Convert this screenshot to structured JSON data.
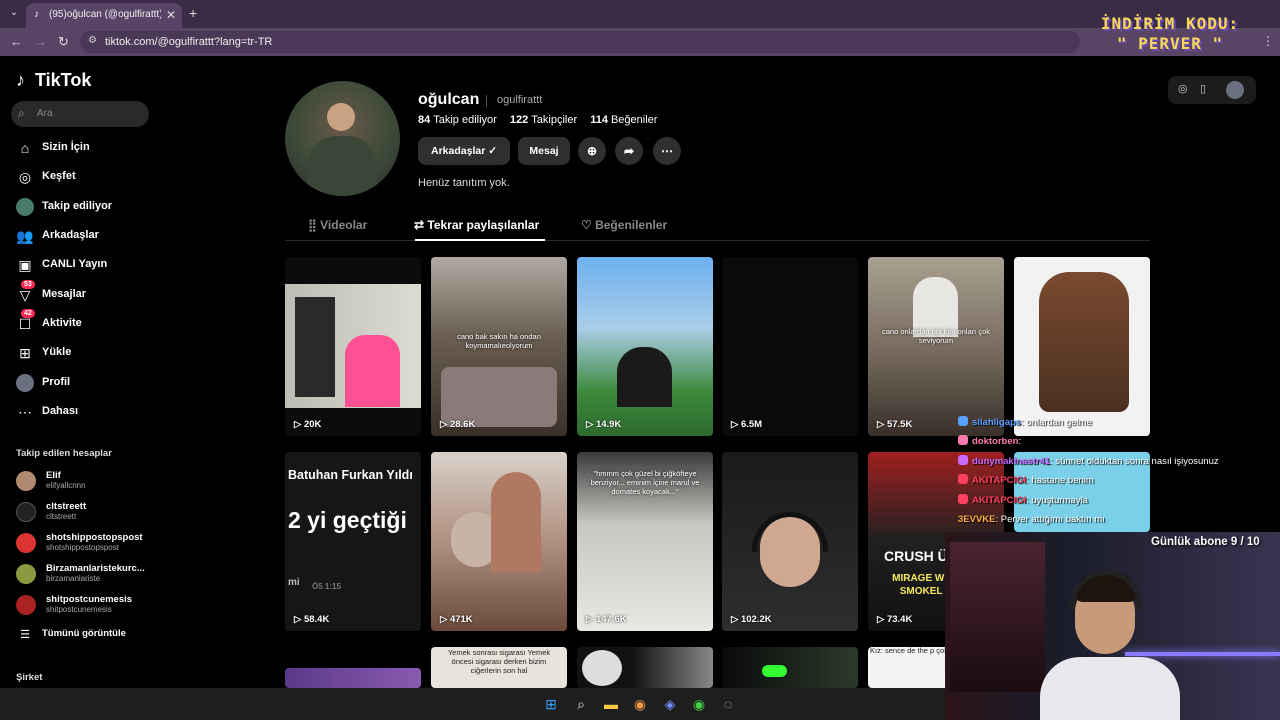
{
  "browser": {
    "tab_title": "(95)oğulcan (@ogulfirattt) | Tik",
    "tab_close": "✕",
    "new_tab": "+",
    "url": "tiktok.com/@ogulfirattt?lang=tr-TR"
  },
  "promo": {
    "line1": "İNDİRİM KODU:",
    "line2": "\" PERVER \""
  },
  "sidebar": {
    "logo": "TikTok",
    "search_placeholder": "Ara",
    "nav": [
      {
        "label": "Sizin İçin",
        "icon": "home-icon"
      },
      {
        "label": "Keşfet",
        "icon": "compass-icon"
      },
      {
        "label": "Takip ediliyor",
        "icon": "following-avatar-icon"
      },
      {
        "label": "Arkadaşlar",
        "icon": "friends-icon"
      },
      {
        "label": "CANLI Yayın",
        "icon": "live-icon"
      },
      {
        "label": "Mesajlar",
        "icon": "messages-icon",
        "badge": "53"
      },
      {
        "label": "Aktivite",
        "icon": "activity-icon",
        "badge": "42"
      },
      {
        "label": "Yükle",
        "icon": "upload-icon"
      },
      {
        "label": "Profil",
        "icon": "profile-avatar-icon"
      },
      {
        "label": "Dahası",
        "icon": "more-icon"
      }
    ],
    "followed_title": "Takip edilen hesaplar",
    "accounts": [
      {
        "name": "Elif",
        "handle": "elifyallcnnn",
        "color": "#b08a70"
      },
      {
        "name": "cltstreett",
        "handle": "cltstreett",
        "color": "#222"
      },
      {
        "name": "shotshippostopspost",
        "handle": "shotshippostopspost",
        "color": "#d33"
      },
      {
        "name": "Birzamanlaristekurc...",
        "handle": "birzamanlariste",
        "color": "#8a9a40"
      },
      {
        "name": "shitpostcunemesis",
        "handle": "shitpostcunemesis",
        "color": "#a22"
      }
    ],
    "view_all": "Tümünü görüntüle",
    "company": "Şirket"
  },
  "profile": {
    "name": "oğulcan",
    "handle": "ogulfirattt",
    "following_count": "84",
    "following_label": "Takip ediliyor",
    "followers_count": "122",
    "followers_label": "Takipçiler",
    "likes_count": "114",
    "likes_label": "Beğeniler",
    "friends_button": "Arkadaşlar ✓",
    "message_button": "Mesaj",
    "bio": "Henüz tanıtım yok."
  },
  "tabs": [
    {
      "label": "Videolar",
      "icon": "grid-icon"
    },
    {
      "label": "Tekrar paylaşılanlar",
      "icon": "repost-icon"
    },
    {
      "label": "Beğenilenler",
      "icon": "heart-icon"
    }
  ],
  "videos": [
    {
      "views": "20K",
      "caption": ""
    },
    {
      "views": "28.6K",
      "caption": "cano bak sakın ha ondan koymamalıeolyorum"
    },
    {
      "views": "14.9K",
      "caption": ""
    },
    {
      "views": "6.5M",
      "caption": ""
    },
    {
      "views": "57.5K",
      "caption": "cano onlardan bol koy onları çok seviyorum"
    },
    {
      "views": "",
      "caption": ""
    },
    {
      "views": "58.4K",
      "caption": "Batuhan Furkan Yıldı",
      "big": "2 yi geçtiği",
      "small": "mi",
      "time": "Ö5 1:15"
    },
    {
      "views": "471K",
      "caption": ""
    },
    {
      "views": "147.6K",
      "caption": "\"hmmm çok güzel bi çiğköfteye benziyor... eminim içine marul ve domates koyacak...\""
    },
    {
      "views": "102.2K",
      "caption": ""
    },
    {
      "views": "73.4K",
      "caption": "CRUSH Ü",
      "big2": "MIRAGE Wİ NASIL SMOKEL BİLMİ"
    },
    {
      "views": "",
      "caption": ""
    },
    {
      "views": "",
      "caption": ""
    },
    {
      "views": "",
      "caption": "Yemek sonrası sigarası Yemek öncesi sigarası derken bizim ciğerlerin son hal"
    },
    {
      "views": "",
      "caption": ""
    },
    {
      "views": "",
      "caption": ""
    },
    {
      "views": "",
      "caption": "Kız: sence de the p çok iyi değil"
    }
  ],
  "chat": [
    {
      "user": "silahligaps",
      "msg": ": onlardan gelme",
      "color": "#5aa0ff"
    },
    {
      "user": "doktorben",
      "msg": ":",
      "color": "#ff7ab0"
    },
    {
      "user": "dunymakinastr41",
      "msg": ": sünnet olduktan sonra nasıl işiyosunuz",
      "color": "#c86aff"
    },
    {
      "user": "AKITAPCIGI",
      "msg": ": hastane benim",
      "color": "#ff4060"
    },
    {
      "user": "AKITAPCIGI",
      "msg": ": uyuşturmayla",
      "color": "#ff4060"
    },
    {
      "user": "3EVVKE",
      "msg": ": Perver attığımı baktın mı",
      "color": "#ffb040"
    }
  ],
  "subs_goal": "Günlük abone 9 / 10"
}
